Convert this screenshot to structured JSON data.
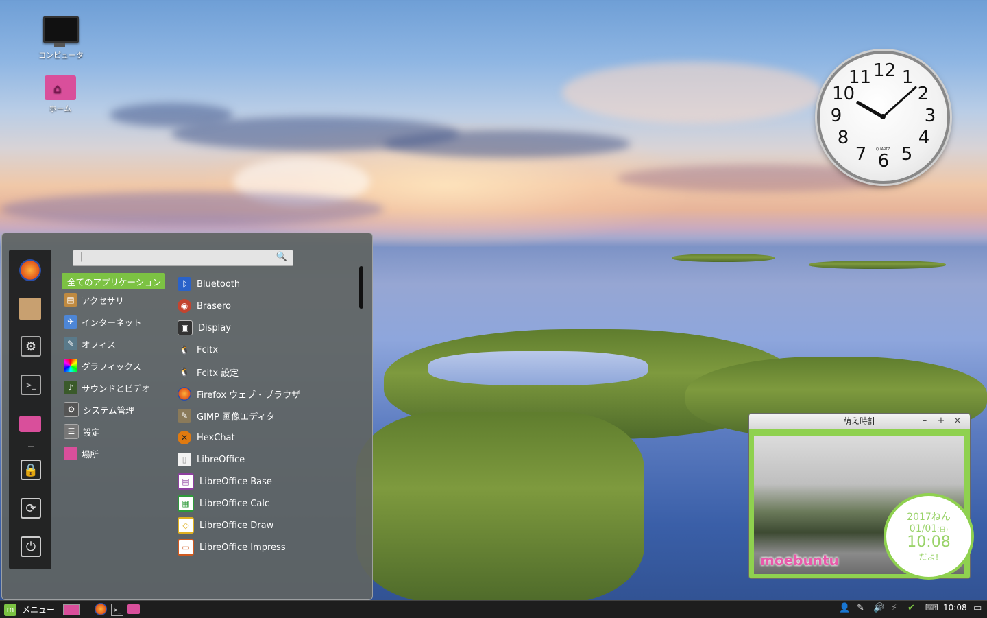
{
  "desktop": {
    "icons": [
      {
        "label": "コンピュータ",
        "icon": "computer-icon"
      },
      {
        "label": "ホーム",
        "icon": "home-folder-icon"
      }
    ]
  },
  "clock": {
    "numbers": [
      "12",
      "1",
      "2",
      "3",
      "4",
      "5",
      "6",
      "7",
      "8",
      "9",
      "10",
      "11"
    ],
    "brand": "QUARTZ",
    "time": "10:08"
  },
  "menu": {
    "search": {
      "value": "|",
      "placeholder": ""
    },
    "favorites": [
      "firefox-icon",
      "package-icon",
      "settings-icon",
      "terminal-icon",
      "folder-icon",
      "lock-icon",
      "logout-icon",
      "power-icon"
    ],
    "categories": [
      {
        "label": "全てのアプリケーション",
        "active": true
      },
      {
        "label": "アクセサリ"
      },
      {
        "label": "インターネット"
      },
      {
        "label": "オフィス"
      },
      {
        "label": "グラフィックス"
      },
      {
        "label": "サウンドとビデオ"
      },
      {
        "label": "システム管理"
      },
      {
        "label": "設定"
      },
      {
        "label": "場所"
      }
    ],
    "apps": [
      {
        "label": "Bluetooth",
        "color": "#2a62c9",
        "glyph": "ᛒ"
      },
      {
        "label": "Brasero",
        "color": "#c4442f",
        "glyph": "◉"
      },
      {
        "label": "Display",
        "color": "#333333",
        "glyph": "▣"
      },
      {
        "label": "Fcitx",
        "color": "#444444",
        "glyph": "🐧"
      },
      {
        "label": "Fcitx 設定",
        "color": "#444444",
        "glyph": "🐧"
      },
      {
        "label": "Firefox ウェブ・ブラウザ",
        "color": "#e66b1a",
        "glyph": "◐"
      },
      {
        "label": "GIMP 画像エディタ",
        "color": "#8a7a5a",
        "glyph": "✎"
      },
      {
        "label": "HexChat",
        "color": "#e07a10",
        "glyph": "✕"
      },
      {
        "label": "LibreOffice",
        "color": "#f2f2f2",
        "glyph": "▯"
      },
      {
        "label": "LibreOffice Base",
        "color": "#8e3fa0",
        "glyph": "▤"
      },
      {
        "label": "LibreOffice Calc",
        "color": "#2e9a3a",
        "glyph": "▦"
      },
      {
        "label": "LibreOffice Draw",
        "color": "#e0b020",
        "glyph": "◇"
      },
      {
        "label": "LibreOffice Impress",
        "color": "#d05a20",
        "glyph": "▭"
      }
    ]
  },
  "moe_widget": {
    "title": "萌え時計",
    "buttons": [
      "–",
      "+",
      "×"
    ],
    "year": "2017ねん",
    "date": "01/01",
    "weekday": "(日)",
    "time": "10:08",
    "suffix": "だよ!",
    "logo": "moebuntu"
  },
  "taskbar": {
    "menu_label": "メニュー",
    "launchers": [
      "desktop-icon",
      "firefox-icon",
      "terminal-icon",
      "folder-icon"
    ],
    "tray_icons": [
      "user-icon",
      "pen-icon",
      "volume-icon",
      "shield-icon",
      "keyboard-icon"
    ],
    "time": "10:08"
  }
}
